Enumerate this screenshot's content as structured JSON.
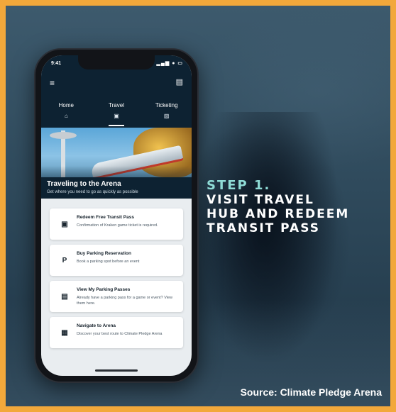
{
  "colors": {
    "border": "#f2a83b",
    "accent": "#8fdcd6",
    "app_header": "#0d2232"
  },
  "phone": {
    "status_time": "9:41",
    "status_icons": "▂▄▆ ● ▭",
    "menu_icon": "≡",
    "chat_icon": "▤",
    "tabs": [
      {
        "label": "Home",
        "icon": "⌂"
      },
      {
        "label": "Travel",
        "icon": "▣"
      },
      {
        "label": "Ticketing",
        "icon": "▧"
      }
    ],
    "active_tab": "Travel",
    "banner": {
      "title": "Traveling to the Arena",
      "subtitle": "Get where you need to go as quickly as possible"
    },
    "cards": [
      {
        "icon": "▣",
        "icon_name": "bus-icon",
        "title": "Redeem Free Transit Pass",
        "desc": "Confirmation of Kraken game ticket is required."
      },
      {
        "icon": "P",
        "icon_name": "parking-icon",
        "title": "Buy Parking Reservation",
        "desc": "Book a parking spot before an event"
      },
      {
        "icon": "▤",
        "icon_name": "car-icon",
        "title": "View My Parking Passes",
        "desc": "Already have a parking pass for a game or event? View them here."
      },
      {
        "icon": "▦",
        "icon_name": "map-icon",
        "title": "Navigate to Arena",
        "desc": "Discover your best route to Climate Pledge Arena"
      }
    ]
  },
  "overlay": {
    "step": "STEP 1.",
    "lines": [
      "VISIT TRAVEL",
      "HUB AND REDEEM",
      "TRANSIT PASS"
    ]
  },
  "source": "Source: Climate Pledge Arena"
}
